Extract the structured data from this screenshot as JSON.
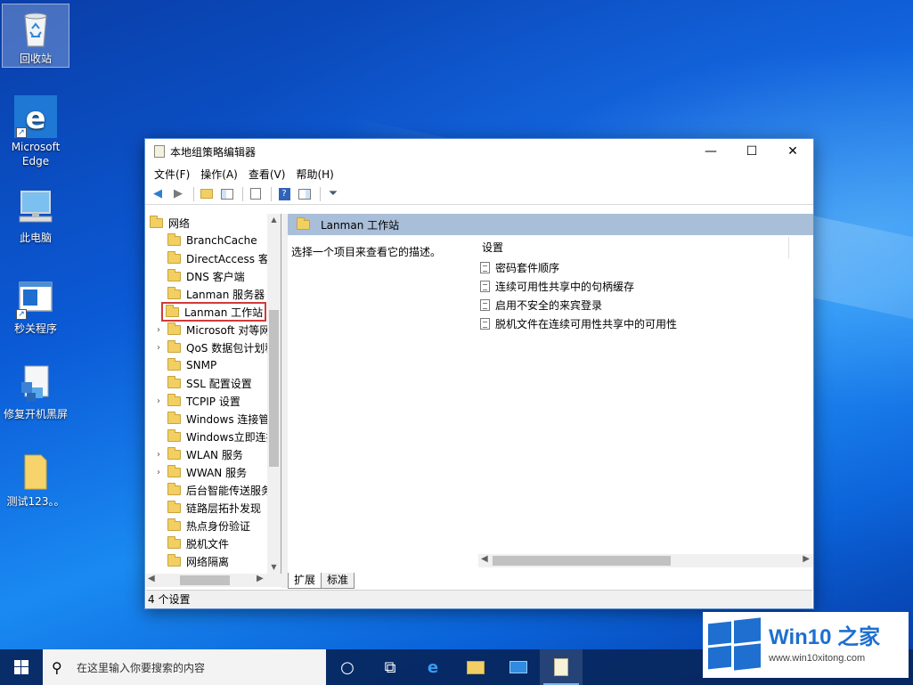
{
  "desktop": {
    "icons": [
      {
        "label": "回收站"
      },
      {
        "label": "Microsoft Edge"
      },
      {
        "label": "此电脑"
      },
      {
        "label": "秒关程序"
      },
      {
        "label": "修复开机黑屏"
      },
      {
        "label": "测试123。。"
      }
    ]
  },
  "window": {
    "title": "本地组策略编辑器",
    "controls": {
      "minimize": "—",
      "maximize": "☐",
      "close": "✕"
    },
    "menu": [
      "文件(F)",
      "操作(A)",
      "查看(V)",
      "帮助(H)"
    ],
    "tree": {
      "root": "网络",
      "items": [
        {
          "label": "BranchCache",
          "expandable": false
        },
        {
          "label": "DirectAccess 客户",
          "expandable": false
        },
        {
          "label": "DNS 客户端",
          "expandable": false
        },
        {
          "label": "Lanman 服务器",
          "expandable": false
        },
        {
          "label": "Lanman 工作站",
          "expandable": false,
          "selected": true
        },
        {
          "label": "Microsoft 对等网",
          "expandable": true
        },
        {
          "label": "QoS 数据包计划程",
          "expandable": true
        },
        {
          "label": "SNMP",
          "expandable": false
        },
        {
          "label": "SSL 配置设置",
          "expandable": false
        },
        {
          "label": "TCPIP 设置",
          "expandable": true
        },
        {
          "label": "Windows 连接管",
          "expandable": false
        },
        {
          "label": "Windows立即连接",
          "expandable": false
        },
        {
          "label": "WLAN 服务",
          "expandable": true
        },
        {
          "label": "WWAN 服务",
          "expandable": true
        },
        {
          "label": "后台智能传送服务",
          "expandable": false
        },
        {
          "label": "链路层拓扑发现",
          "expandable": false
        },
        {
          "label": "热点身份验证",
          "expandable": false
        },
        {
          "label": "脱机文件",
          "expandable": false
        },
        {
          "label": "网络隔离",
          "expandable": false
        }
      ]
    },
    "right": {
      "header": "Lanman 工作站",
      "description": "选择一个项目来查看它的描述。",
      "column_header": "设置",
      "settings": [
        "密码套件顺序",
        "连续可用性共享中的句柄缓存",
        "启用不安全的来宾登录",
        "脱机文件在连续可用性共享中的可用性"
      ],
      "tabs": [
        "扩展",
        "标准"
      ]
    },
    "status": "4 个设置"
  },
  "taskbar": {
    "search_placeholder": "在这里输入你要搜索的内容"
  },
  "watermark": {
    "brand": "Win10 之家",
    "url": "www.win10xitong.com"
  },
  "colors": {
    "accent": "#1e6fd0",
    "highlight_box": "#d23a3a",
    "pane_header": "#a9bed8"
  }
}
